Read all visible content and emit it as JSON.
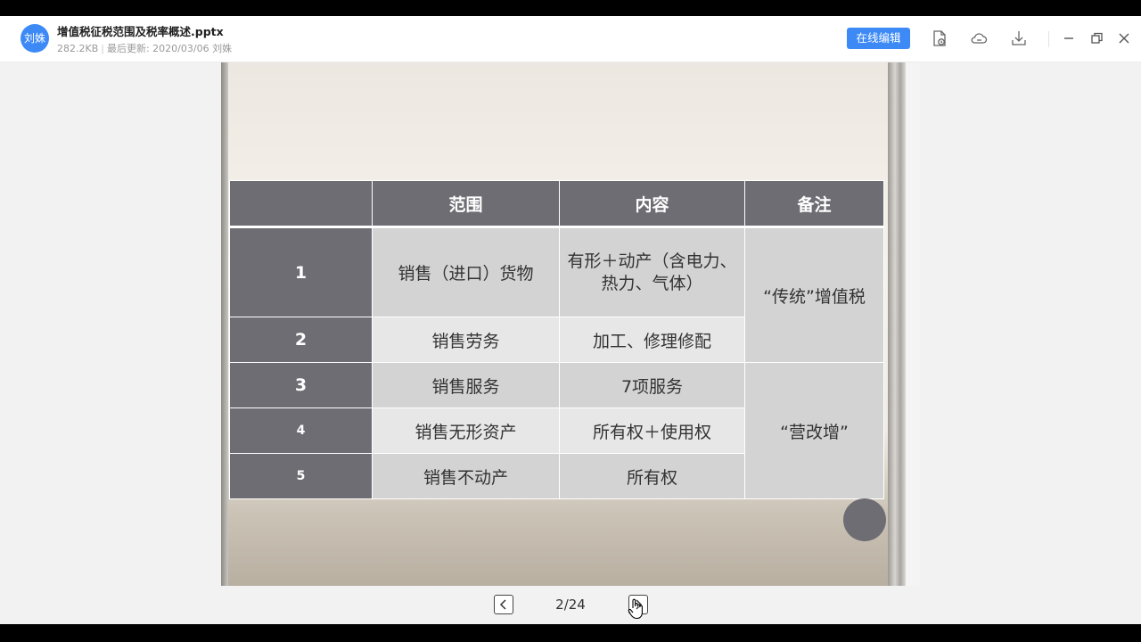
{
  "header": {
    "avatar_text": "刘姝",
    "file_name": "增值税征税范围及税率概述.pptx",
    "file_size": "282.2KB",
    "updated_text": "最后更新: 2020/03/06 刘姝",
    "edit_button": "在线编辑",
    "icons": [
      "document-info-icon",
      "cloud-icon",
      "download-icon",
      "minimize-icon",
      "restore-icon",
      "close-icon"
    ]
  },
  "slide": {
    "table": {
      "headers": [
        "",
        "范围",
        "内容",
        "备注"
      ],
      "rows": [
        {
          "num": "1",
          "scope": "销售（进口）货物",
          "content_line1": "有形＋动产（含电力、",
          "content_line2": "热力、气体）"
        },
        {
          "num": "2",
          "scope": "销售劳务",
          "content": "加工、修理修配"
        },
        {
          "num": "3",
          "scope": "销售服务",
          "content": "7项服务"
        },
        {
          "num": "4",
          "scope": "销售无形资产",
          "content": "所有权＋使用权"
        },
        {
          "num": "5",
          "scope": "销售不动产",
          "content": "所有权"
        }
      ],
      "notes": [
        "“传统”增值税",
        "“营改增”"
      ]
    },
    "colors": {
      "header_bg": "#6e6d73",
      "cell_dark": "#d3d3d3",
      "cell_light": "#e7e7e7"
    }
  },
  "footer": {
    "page_indicator": "2/24",
    "prev_icon": "chevron-left-icon",
    "next_icon": "chevron-right-icon"
  },
  "accent_color": "#3d8af7"
}
